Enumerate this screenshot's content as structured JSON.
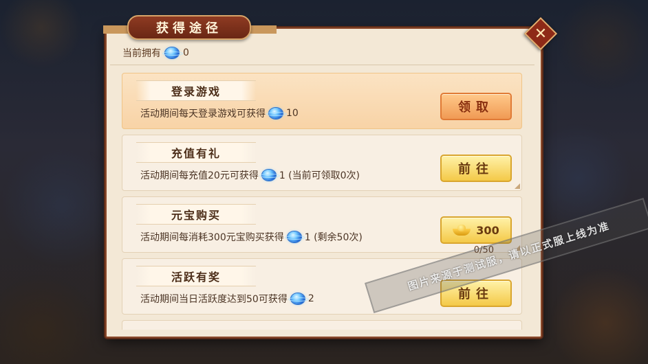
{
  "dialog": {
    "title": "获得途径",
    "close_icon": "close-x-icon"
  },
  "header": {
    "label": "当前拥有",
    "icon": "blue-orb-icon",
    "count": "0"
  },
  "tasks": [
    {
      "name": "登录游戏",
      "desc_prefix": "活动期间每天登录游戏可获得",
      "reward_icon": "blue-orb-icon",
      "reward": "10",
      "button": "领取",
      "button_style": "claim",
      "highlighted": true
    },
    {
      "name": "充值有礼",
      "desc_prefix": "活动期间每充值20元可获得",
      "reward_icon": "blue-orb-icon",
      "reward": "1 (当前可领取0次)",
      "button": "前往",
      "button_style": "go"
    },
    {
      "name": "元宝购买",
      "desc_prefix": "活动期间每消耗300元宝购买获得",
      "reward_icon": "blue-orb-icon",
      "reward": "1 (剩余50次)",
      "button": "300",
      "button_icon": "gold-ingot-icon",
      "button_style": "purchase"
    },
    {
      "name": "活跃有奖",
      "desc_prefix": "活动期间当日活跃度达到50可获得",
      "reward_icon": "blue-orb-icon",
      "reward": "2",
      "progress": "0/50",
      "button": "前往",
      "button_style": "go"
    }
  ],
  "watermark": "图片来源于测试服，请以正式服上线为准",
  "colors": {
    "panel_bg": "#f3e8d6",
    "panel_border": "#8b4a2c",
    "title_plaque": "#8e3b22",
    "claim_button": "#f09a54",
    "go_button": "#f4c948"
  }
}
